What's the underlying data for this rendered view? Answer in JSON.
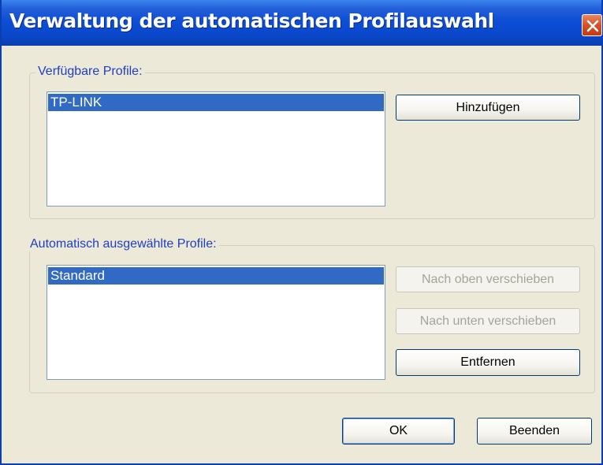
{
  "window": {
    "title": "Verwaltung der automatischen Profilauswahl"
  },
  "available_profiles": {
    "group_label": "Verfügbare Profile:",
    "items": [
      "TP-LINK"
    ],
    "add_button": "Hinzufügen"
  },
  "auto_profiles": {
    "group_label": "Automatisch ausgewählte Profile:",
    "items": [
      "Standard"
    ],
    "move_up_button": "Nach oben verschieben",
    "move_down_button": "Nach unten verschieben",
    "remove_button": "Entfernen"
  },
  "footer": {
    "ok_button": "OK",
    "cancel_button": "Beenden"
  },
  "colors": {
    "title_bar": "#0a48cc",
    "selection": "#316ac5",
    "group_label": "#1f3fbf",
    "dialog_bg": "#ece9d8"
  },
  "icons": {
    "close": "close-icon"
  }
}
